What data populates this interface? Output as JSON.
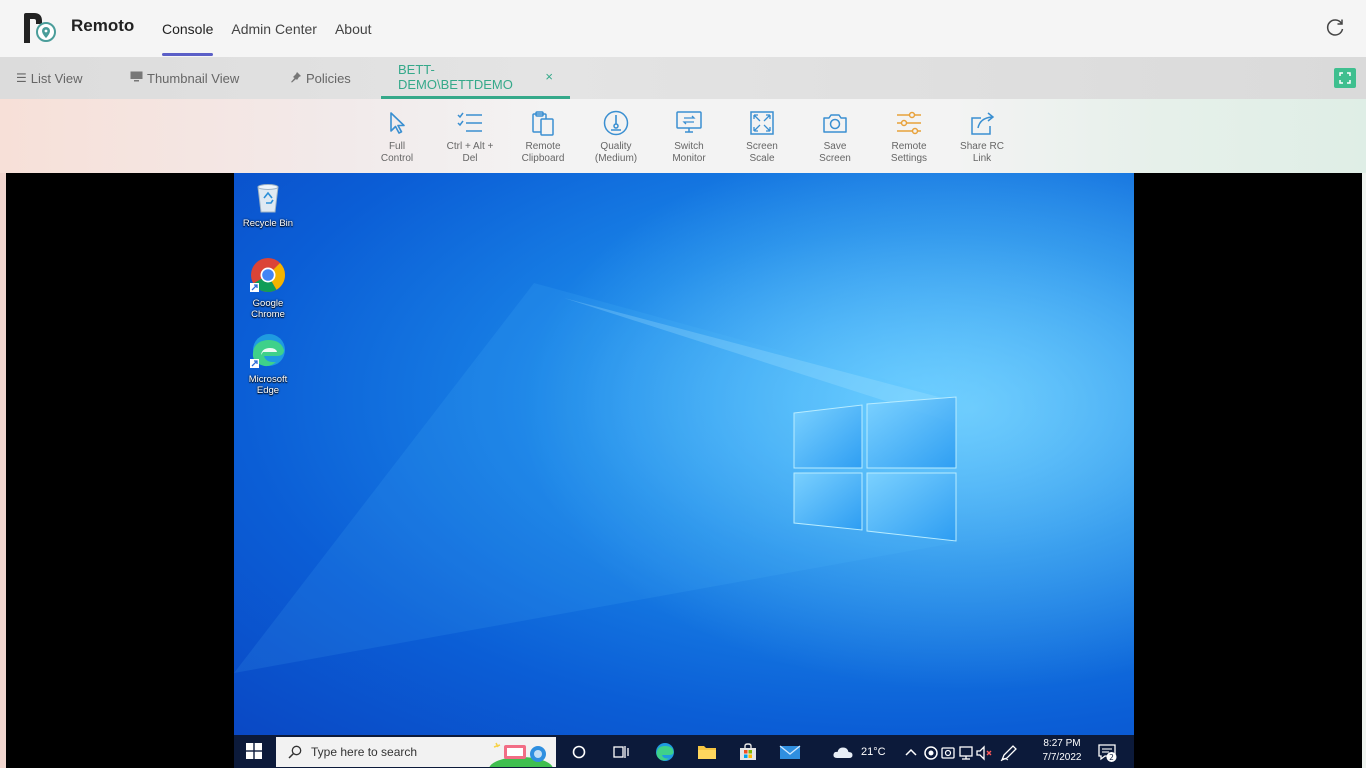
{
  "app": {
    "brand": "Remoto",
    "nav": [
      {
        "label": "Console",
        "active": true
      },
      {
        "label": "Admin Center",
        "active": false
      },
      {
        "label": "About",
        "active": false
      }
    ]
  },
  "tabs": {
    "list_view": "List View",
    "thumbnail_view": "Thumbnail View",
    "policies": "Policies",
    "session": "BETT-DEMO\\BETTDEMO",
    "close_glyph": "×"
  },
  "toolbar": [
    {
      "line1": "Full",
      "line2": "Control",
      "icon": "cursor-icon"
    },
    {
      "line1": "Ctrl + Alt +",
      "line2": "Del",
      "icon": "checklist-icon"
    },
    {
      "line1": "Remote",
      "line2": "Clipboard",
      "icon": "clipboard-icon"
    },
    {
      "line1": "Quality",
      "line2": "(Medium)",
      "icon": "gauge-icon"
    },
    {
      "line1": "Switch",
      "line2": "Monitor",
      "icon": "monitor-icon"
    },
    {
      "line1": "Screen",
      "line2": "Scale",
      "icon": "scale-icon"
    },
    {
      "line1": "Save",
      "line2": "Screen",
      "icon": "camera-icon"
    },
    {
      "line1": "Remote",
      "line2": "Settings",
      "icon": "sliders-icon"
    },
    {
      "line1": "Share RC",
      "line2": "Link",
      "icon": "share-icon"
    }
  ],
  "desktop": {
    "icons": [
      {
        "label_line1": "Recycle Bin",
        "label_line2": ""
      },
      {
        "label_line1": "Google",
        "label_line2": "Chrome"
      },
      {
        "label_line1": "Microsoft",
        "label_line2": "Edge"
      }
    ]
  },
  "taskbar": {
    "search_placeholder": "Type here to search",
    "weather": "21°C",
    "time": "8:27 PM",
    "date": "7/7/2022",
    "notification_count": "2"
  },
  "colors": {
    "accent": "#35a98a",
    "nav_underline": "#5b5fc7",
    "toolbar_icon_blue": "#3a8fd1",
    "toolbar_icon_orange": "#e8a13a"
  }
}
